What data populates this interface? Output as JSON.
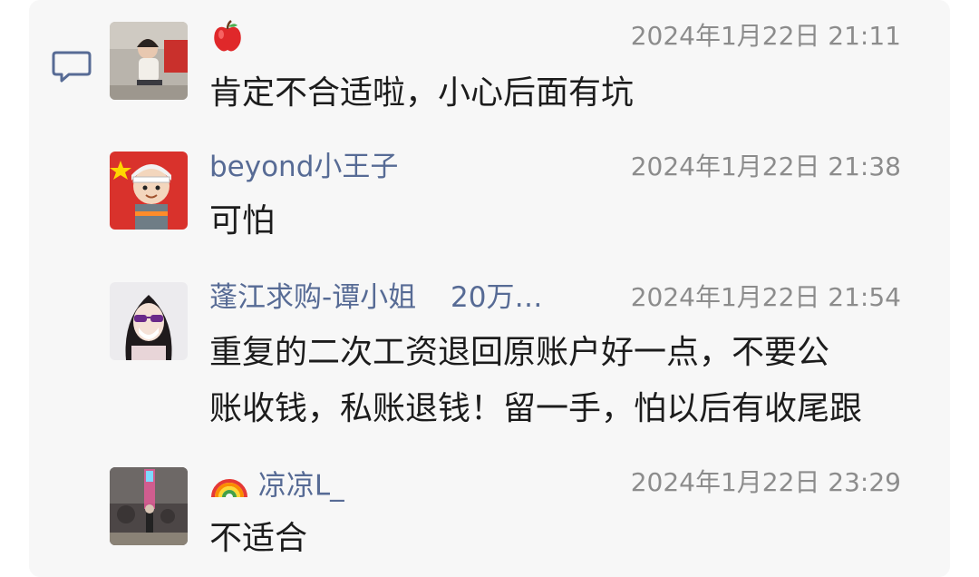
{
  "comments": [
    {
      "name": "",
      "name_emoji": "apple-icon",
      "time": "2024年1月22日 21:11",
      "text": "肯定不合适啦，小心后面有坑"
    },
    {
      "name": "beyond小王子",
      "time": "2024年1月22日 21:38",
      "text": "可怕"
    },
    {
      "name": "蓬江求购-谭小姐",
      "name_extra": "20万…",
      "time": "2024年1月22日 21:54",
      "text_lines": [
        "重复的二次工资退回原账户好一点，不要公",
        "账收钱，私账退钱！留一手，怕以后有收尾跟"
      ]
    },
    {
      "name": "凉凉L_",
      "name_emoji": "rainbow-icon",
      "time": "2024年1月22日 23:29",
      "text": "不适合"
    }
  ],
  "colors": {
    "name": "#576b95",
    "time": "#8c8c8c",
    "text": "#1c1c1c",
    "panel": "#f7f7f7"
  }
}
